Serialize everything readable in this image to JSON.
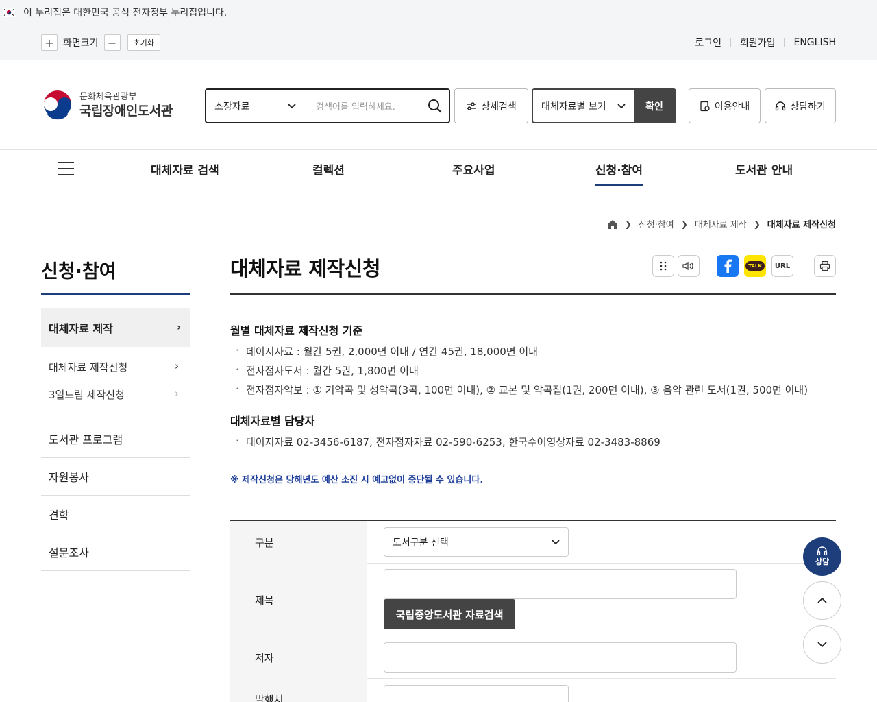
{
  "gov_banner": {
    "text": "이 누리집은 대한민국 공식 전자정부 누리집입니다."
  },
  "util": {
    "zoom_label": "화면크기",
    "zoom_in": "+",
    "zoom_out": "−",
    "reset": "초기화",
    "links": [
      "로그인",
      "회원가입",
      "ENGLISH"
    ]
  },
  "header": {
    "logo_top": "문화체육관광부",
    "logo_main": "국립장애인도서관",
    "search_select": "소장자료",
    "search_placeholder": "검색어를 입력하세요.",
    "detail_search": "상세검색",
    "view_select": "대체자료별 보기",
    "confirm": "확인",
    "guide": "이용안내",
    "consult": "상담하기"
  },
  "gnb": [
    "대체자료 검색",
    "컬렉션",
    "주요사업",
    "신청·참여",
    "도서관 안내"
  ],
  "breadcrumb": [
    "신청·참여",
    "대체자료 제작",
    "대체자료 제작신청"
  ],
  "lnb": {
    "title": "신청·참여",
    "active": "대체자료 제작",
    "subs": [
      "대체자료 제작신청",
      "3일드림 제작신청"
    ],
    "items": [
      "도서관 프로그램",
      "자원봉사",
      "견학",
      "설문조사"
    ]
  },
  "content": {
    "title": "대체자료 제작신청",
    "share": {
      "url": "URL",
      "talk": "TALK"
    },
    "sec1": "월별 대체자료 제작신청 기준",
    "bullets1": [
      "데이지자료 : 월간 5권, 2,000면 이내 / 연간 45권, 18,000면 이내",
      "전자점자도서 : 월간 5권, 1,800면 이내",
      "전자점자악보 : ① 기악곡 및 성악곡(3곡, 100면 이내), ② 교본 및 악곡집(1권, 200면 이내), ③ 음악 관련 도서(1권, 500면 이내)"
    ],
    "sec2": "대체자료별 담당자",
    "bullets2": [
      "데이지자료 02-3456-6187, 전자점자자료 02-590-6253, 한국수어영상자료 02-3483-8869"
    ],
    "notice": "※ 제작신청은 당해년도 예산 소진 시 예고없이 중단될 수 있습니다."
  },
  "form": {
    "labels": [
      "구분",
      "제목",
      "저자",
      "발행처"
    ],
    "category_select": "도서구분 선택",
    "search_btn": "국립중앙도서관 자료검색"
  },
  "floating": {
    "consult": "상담"
  },
  "colors": {
    "primary": "#1d3e7a",
    "dark": "#444444",
    "notice": "#1d3e9a"
  }
}
